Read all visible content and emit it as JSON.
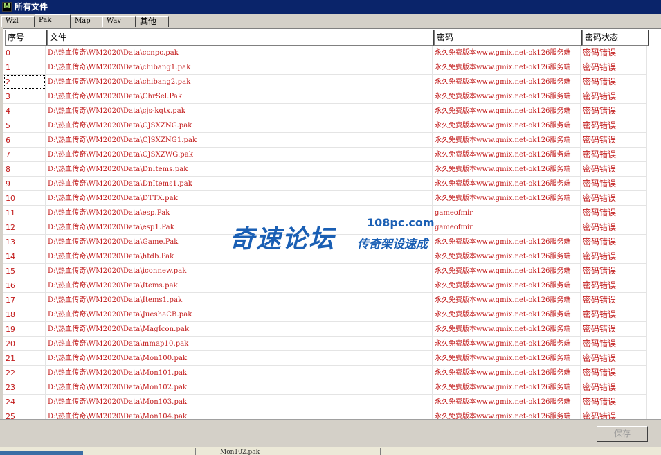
{
  "window": {
    "title": "所有文件",
    "icon_glyph": "M"
  },
  "tabs": [
    {
      "label": "Wzl",
      "active": false
    },
    {
      "label": "Pak",
      "active": true
    },
    {
      "label": "Map",
      "active": false
    },
    {
      "label": "Wav",
      "active": false
    },
    {
      "label": "其他",
      "active": false
    }
  ],
  "table": {
    "columns": [
      "序号",
      "文件",
      "密码",
      "密码状态"
    ],
    "rows": [
      {
        "idx": "0",
        "file": "D:\\热血传奇\\WM2020\\Data\\ccnpc.pak",
        "password": "永久免费版本www.gmix.net-ok126服务端",
        "status": "密码错误"
      },
      {
        "idx": "1",
        "file": "D:\\热血传奇\\WM2020\\Data\\chibang1.pak",
        "password": "永久免费版本www.gmix.net-ok126服务端",
        "status": "密码错误"
      },
      {
        "idx": "2",
        "file": "D:\\热血传奇\\WM2020\\Data\\chibang2.pak",
        "password": "永久免费版本www.gmix.net-ok126服务端",
        "status": "密码错误"
      },
      {
        "idx": "3",
        "file": "D:\\热血传奇\\WM2020\\Data\\ChrSel.Pak",
        "password": "永久免费版本www.gmix.net-ok126服务端",
        "status": "密码错误"
      },
      {
        "idx": "4",
        "file": "D:\\热血传奇\\WM2020\\Data\\cjs-kqtx.pak",
        "password": "永久免费版本www.gmix.net-ok126服务端",
        "status": "密码错误"
      },
      {
        "idx": "5",
        "file": "D:\\热血传奇\\WM2020\\Data\\CJSXZNG.pak",
        "password": "永久免费版本www.gmix.net-ok126服务端",
        "status": "密码错误"
      },
      {
        "idx": "6",
        "file": "D:\\热血传奇\\WM2020\\Data\\CJSXZNG1.pak",
        "password": "永久免费版本www.gmix.net-ok126服务端",
        "status": "密码错误"
      },
      {
        "idx": "7",
        "file": "D:\\热血传奇\\WM2020\\Data\\CJSXZWG.pak",
        "password": "永久免费版本www.gmix.net-ok126服务端",
        "status": "密码错误"
      },
      {
        "idx": "8",
        "file": "D:\\热血传奇\\WM2020\\Data\\DnItems.pak",
        "password": "永久免费版本www.gmix.net-ok126服务端",
        "status": "密码错误"
      },
      {
        "idx": "9",
        "file": "D:\\热血传奇\\WM2020\\Data\\DnItems1.pak",
        "password": "永久免费版本www.gmix.net-ok126服务端",
        "status": "密码错误"
      },
      {
        "idx": "10",
        "file": "D:\\热血传奇\\WM2020\\Data\\DTTX.pak",
        "password": "永久免费版本www.gmix.net-ok126服务端",
        "status": "密码错误"
      },
      {
        "idx": "11",
        "file": "D:\\热血传奇\\WM2020\\Data\\esp.Pak",
        "password": "gameofmir",
        "status": "密码错误"
      },
      {
        "idx": "12",
        "file": "D:\\热血传奇\\WM2020\\Data\\esp1.Pak",
        "password": "gameofmir",
        "status": "密码错误"
      },
      {
        "idx": "13",
        "file": "D:\\热血传奇\\WM2020\\Data\\Game.Pak",
        "password": "永久免费版本www.gmix.net-ok126服务端",
        "status": "密码错误"
      },
      {
        "idx": "14",
        "file": "D:\\热血传奇\\WM2020\\Data\\htdb.Pak",
        "password": "永久免费版本www.gmix.net-ok126服务端",
        "status": "密码错误"
      },
      {
        "idx": "15",
        "file": "D:\\热血传奇\\WM2020\\Data\\iconnew.pak",
        "password": "永久免费版本www.gmix.net-ok126服务端",
        "status": "密码错误"
      },
      {
        "idx": "16",
        "file": "D:\\热血传奇\\WM2020\\Data\\Items.pak",
        "password": "永久免费版本www.gmix.net-ok126服务端",
        "status": "密码错误"
      },
      {
        "idx": "17",
        "file": "D:\\热血传奇\\WM2020\\Data\\Items1.pak",
        "password": "永久免费版本www.gmix.net-ok126服务端",
        "status": "密码错误"
      },
      {
        "idx": "18",
        "file": "D:\\热血传奇\\WM2020\\Data\\JueshaCB.pak",
        "password": "永久免费版本www.gmix.net-ok126服务端",
        "status": "密码错误"
      },
      {
        "idx": "19",
        "file": "D:\\热血传奇\\WM2020\\Data\\MagIcon.pak",
        "password": "永久免费版本www.gmix.net-ok126服务端",
        "status": "密码错误"
      },
      {
        "idx": "20",
        "file": "D:\\热血传奇\\WM2020\\Data\\mmap10.pak",
        "password": "永久免费版本www.gmix.net-ok126服务端",
        "status": "密码错误"
      },
      {
        "idx": "21",
        "file": "D:\\热血传奇\\WM2020\\Data\\Mon100.pak",
        "password": "永久免费版本www.gmix.net-ok126服务端",
        "status": "密码错误"
      },
      {
        "idx": "22",
        "file": "D:\\热血传奇\\WM2020\\Data\\Mon101.pak",
        "password": "永久免费版本www.gmix.net-ok126服务端",
        "status": "密码错误"
      },
      {
        "idx": "23",
        "file": "D:\\热血传奇\\WM2020\\Data\\Mon102.pak",
        "password": "永久免费版本www.gmix.net-ok126服务端",
        "status": "密码错误"
      },
      {
        "idx": "24",
        "file": "D:\\热血传奇\\WM2020\\Data\\Mon103.pak",
        "password": "永久免费版本www.gmix.net-ok126服务端",
        "status": "密码错误"
      },
      {
        "idx": "25",
        "file": "D:\\热血传奇\\WM2020\\Data\\Mon104.pak",
        "password": "永久免费版本www.gmix.net-ok126服务端",
        "status": "密码错误"
      }
    ]
  },
  "watermark": {
    "main": "奇速论坛",
    "site": "108pc.com",
    "sub": "传奇架设速成"
  },
  "footer": {
    "save_label": "保存"
  },
  "behind_window": {
    "peek_text": "Mon102.pak"
  },
  "colors": {
    "title_bar": "#0a246a",
    "row_text": "#c21a1a",
    "watermark": "#1a5fb4",
    "dialog_face": "#d4d0c8"
  }
}
